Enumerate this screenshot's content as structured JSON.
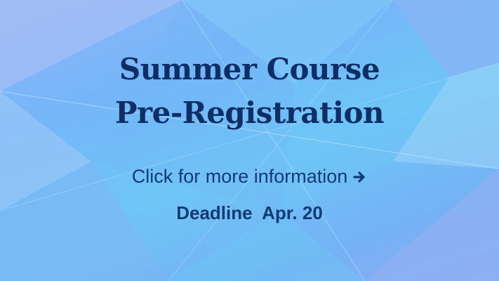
{
  "banner": {
    "title_line_1": "Summer Course",
    "title_line_2": "Pre-Registration",
    "cta_text": "Click for more information",
    "cta_icon": "right-arrow-icon",
    "deadline": "Deadline  Apr. 20"
  },
  "colors": {
    "title": "#0f2e66",
    "text": "#133a78",
    "background": "#74b6f8"
  }
}
